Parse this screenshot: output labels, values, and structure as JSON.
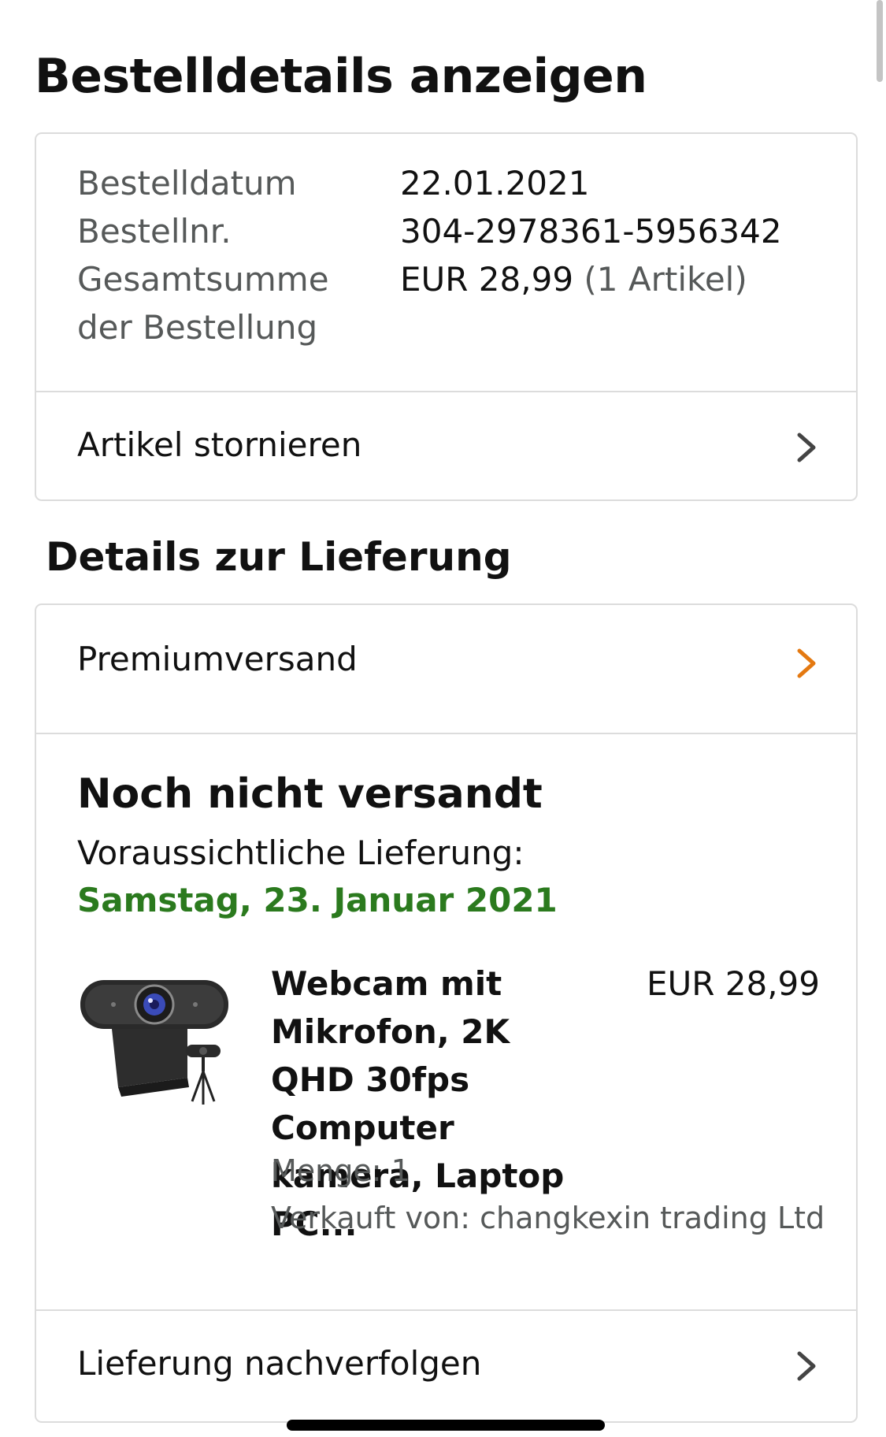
{
  "page": {
    "title": "Bestelldetails anzeigen"
  },
  "summary": {
    "rows": [
      {
        "label": "Bestelldatum",
        "value": "22.01.2021"
      },
      {
        "label": "Bestellnr.",
        "value": "304-2978361-5956342"
      },
      {
        "label": "Gesamtsumme",
        "value": "EUR 28,99",
        "value_extra": "(1 Artikel)"
      },
      {
        "label": "der Bestellung"
      }
    ],
    "cancel_label": "Artikel stornieren"
  },
  "delivery": {
    "section_title": "Details zur Lieferung",
    "shipping_label": "Premiumversand",
    "status": "Noch nicht versandt",
    "eta_label": "Voraussichtliche Lieferung:",
    "eta_date": "Samstag, 23. Januar 2021",
    "product": {
      "image_icon": "webcam-product-image",
      "title": "Webcam mit Mikrofon, 2K QHD 30fps Computer kamera, Laptop PC...",
      "price": "EUR 28,99",
      "quantity": "Menge: 1",
      "seller": "Verkauft von: changkexin trading Ltd"
    },
    "track_label": "Lieferung nachverfolgen"
  },
  "colors": {
    "accent_orange": "#e47911",
    "delivery_green": "#2b7a1e",
    "muted_text": "#565959"
  }
}
